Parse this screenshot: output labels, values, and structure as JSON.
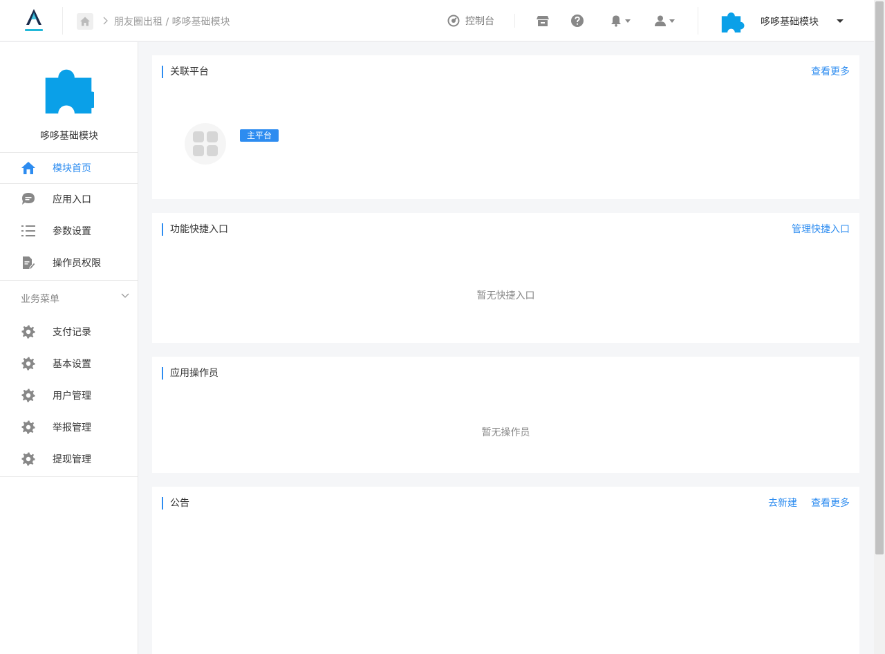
{
  "header": {
    "breadcrumb": "朋友圈出租 / 哆哆基础模块",
    "console_label": "控制台",
    "module_name": "哆哆基础模块"
  },
  "sidebar": {
    "module_title": "哆哆基础模块",
    "items": [
      {
        "label": "模块首页",
        "icon": "home-icon",
        "active": true
      },
      {
        "label": "应用入口",
        "icon": "chat-bubble-icon",
        "active": false
      },
      {
        "label": "参数设置",
        "icon": "list-settings-icon",
        "active": false
      },
      {
        "label": "操作员权限",
        "icon": "document-edit-icon",
        "active": false
      }
    ],
    "group_label": "业务菜单",
    "business_items": [
      {
        "label": "支付记录",
        "icon": "gear-icon"
      },
      {
        "label": "基本设置",
        "icon": "gear-icon"
      },
      {
        "label": "用户管理",
        "icon": "gear-icon"
      },
      {
        "label": "举报管理",
        "icon": "gear-icon"
      },
      {
        "label": "提现管理",
        "icon": "gear-icon"
      }
    ]
  },
  "cards": {
    "platform": {
      "title": "关联平台",
      "link": "查看更多",
      "badge": "主平台"
    },
    "shortcuts": {
      "title": "功能快捷入口",
      "link": "管理快捷入口",
      "empty": "暂无快捷入口"
    },
    "operators": {
      "title": "应用操作员",
      "empty": "暂无操作员"
    },
    "notice": {
      "title": "公告",
      "link_new": "去新建",
      "link_more": "查看更多"
    }
  },
  "colors": {
    "accent": "#2d8cf0",
    "puzzle": "#0aa0e8"
  }
}
